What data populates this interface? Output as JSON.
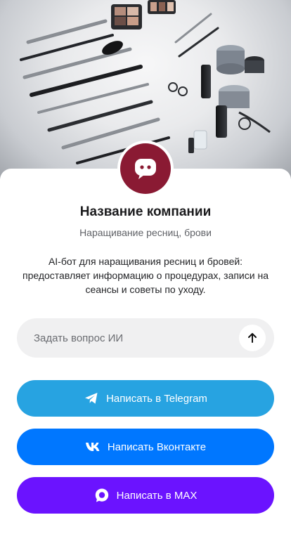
{
  "hero": {
    "image": "lash-and-brow-tools-photo"
  },
  "profile": {
    "avatar_icon": "chat-bubble-icon",
    "avatar_color": "#8a1a33",
    "company_name": "Название компании",
    "subtitle": "Наращивание ресниц, брови",
    "description": "AI-бот для наращивания ресниц и бровей: предоставляет информацию о процедурах, записи на сеансы и советы по уходу."
  },
  "ask": {
    "placeholder": "Задать вопрос ИИ",
    "value": "",
    "send_icon": "arrow-up-icon"
  },
  "actions": [
    {
      "label": "Написать в Telegram",
      "icon": "telegram-icon",
      "color": "#27a3e1"
    },
    {
      "label": "Написать Вконтакте",
      "icon": "vk-icon",
      "color": "#0077ff"
    },
    {
      "label": "Написать в MAX",
      "icon": "max-icon",
      "color": "#6b13ff"
    }
  ]
}
